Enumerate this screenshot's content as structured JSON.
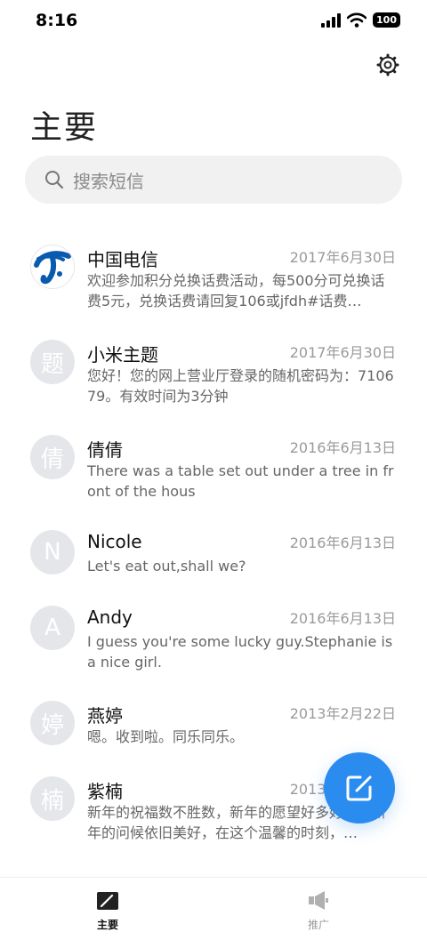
{
  "status_bar": {
    "time": "8:16",
    "battery": "100"
  },
  "header": {
    "title": "主要",
    "settings_icon": "gear-icon"
  },
  "search": {
    "placeholder": "搜索短信",
    "icon": "search-icon"
  },
  "conversations": [
    {
      "name": "中国电信",
      "date": "2017年6月30日",
      "preview": "欢迎参加积分兑换话费活动，每500分可兑换话费5元，兑换话费请回复106或jfdh#话费…",
      "avatar": "",
      "avatar_type": "china-telecom-logo"
    },
    {
      "name": "小米主题",
      "date": "2017年6月30日",
      "preview": "您好！您的网上营业厅登录的随机密码为：710679。有效时间为3分钟",
      "avatar": "题"
    },
    {
      "name": "倩倩",
      "date": "2016年6月13日",
      "preview": "There was a table set out under a tree in front of the hous",
      "avatar": "倩"
    },
    {
      "name": "Nicole",
      "date": "2016年6月13日",
      "preview": "Let's eat out,shall we?",
      "avatar": "N"
    },
    {
      "name": "Andy",
      "date": "2016年6月13日",
      "preview": "I guess you're some lucky guy.Stephanie is a nice girl.",
      "avatar": "A"
    },
    {
      "name": "燕婷",
      "date": "2013年2月22日",
      "preview": "嗯。收到啦。同乐同乐。",
      "avatar": "婷"
    },
    {
      "name": "紫楠",
      "date": "2013年2月22日",
      "preview": "新年的祝福数不胜数，新年的愿望好多好多，新年的问候依旧美好，在这个温馨的时刻，…",
      "avatar": "楠"
    }
  ],
  "fab": {
    "icon": "compose-icon"
  },
  "bottom_nav": {
    "items": [
      {
        "label": "主要",
        "icon": "primary-messages-icon",
        "active": true
      },
      {
        "label": "推广",
        "icon": "megaphone-icon",
        "active": false
      }
    ]
  },
  "colors": {
    "accent": "#2b8cf0",
    "avatar_bg": "#e4e6ea",
    "telecom_blue": "#0a5bb0"
  }
}
